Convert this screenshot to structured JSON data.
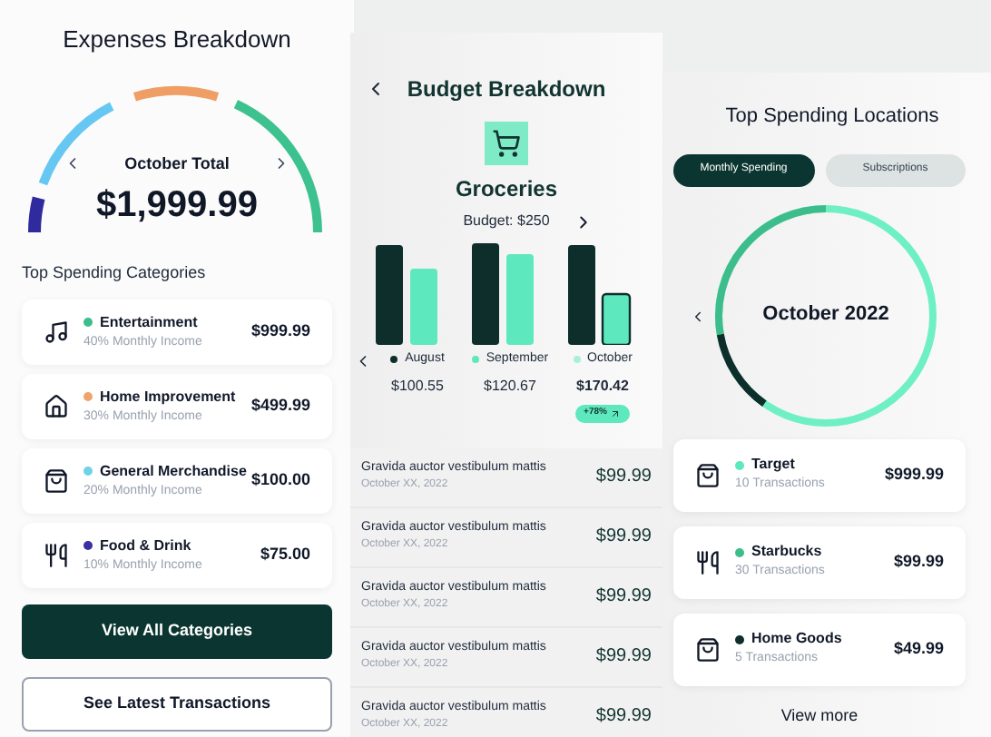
{
  "expenses": {
    "title": "Expenses Breakdown",
    "period_label": "October Total",
    "total": "$1,999.99",
    "section_title": "Top Spending Categories",
    "categories": [
      {
        "kind": "entertainment",
        "name": "Entertainment",
        "note": "40% Monthly Income",
        "amount": "$999.99",
        "color": "#3dbd8c"
      },
      {
        "kind": "home",
        "name": "Home Improvement",
        "note": "30% Monthly Income",
        "amount": "$499.99",
        "color": "#f0a36b"
      },
      {
        "kind": "bag",
        "name": "General Merchandise",
        "note": "20% Monthly Income",
        "amount": "$100.00",
        "color": "#6fd3e6"
      },
      {
        "kind": "food",
        "name": "Food & Drink",
        "note": "10% Monthly Income",
        "amount": "$75.00",
        "color": "#3a2fa3"
      }
    ],
    "primary_button": "View All Categories",
    "secondary_button": "See Latest Transactions"
  },
  "budget": {
    "title": "Budget Breakdown",
    "category": "Groceries",
    "budget": "Budget: $250",
    "months": [
      {
        "label": "August",
        "amount": "$100.55",
        "color": "#0d2e2b",
        "selected": false
      },
      {
        "label": "September",
        "amount": "$120.67",
        "color": "#5ee8bd",
        "selected": false
      },
      {
        "label": "October",
        "amount": "$170.42",
        "color": "#a8f0d8",
        "selected": true
      }
    ],
    "change_badge": "+78%",
    "transactions": [
      {
        "title": "Gravida auctor vestibulum mattis",
        "date": "October XX, 2022",
        "amount": "$99.99"
      },
      {
        "title": "Gravida auctor vestibulum mattis",
        "date": "October XX, 2022",
        "amount": "$99.99"
      },
      {
        "title": "Gravida auctor vestibulum mattis",
        "date": "October XX, 2022",
        "amount": "$99.99"
      },
      {
        "title": "Gravida auctor vestibulum mattis",
        "date": "October XX, 2022",
        "amount": "$99.99"
      },
      {
        "title": "Gravida auctor vestibulum mattis",
        "date": "October XX, 2022",
        "amount": "$99.99"
      }
    ]
  },
  "locations": {
    "title": "Top Spending Locations",
    "tabs": [
      {
        "label": "Monthly Spending",
        "selected": true
      },
      {
        "label": "Subscriptions",
        "selected": false
      }
    ],
    "center_label": "October 2022",
    "items": [
      {
        "kind": "bag",
        "name": "Target",
        "note": "10 Transactions",
        "amount": "$999.99",
        "color": "#5ee8bd"
      },
      {
        "kind": "food",
        "name": "Starbucks",
        "note": "30 Transactions",
        "amount": "$99.99",
        "color": "#3dbd8c"
      },
      {
        "kind": "bag",
        "name": "Home Goods",
        "note": "5 Transactions",
        "amount": "$49.99",
        "color": "#0d2e2b"
      }
    ],
    "view_more": "View more"
  }
}
